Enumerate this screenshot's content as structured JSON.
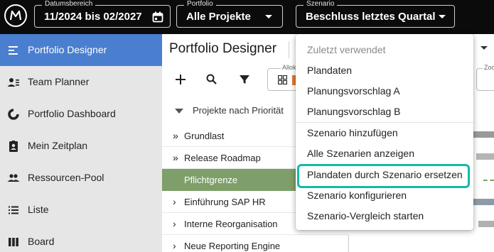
{
  "topbar": {
    "date_range": {
      "label": "Datumsbereich",
      "value": "11/2024 bis 02/2027",
      "icon": "calendar-icon"
    },
    "portfolio": {
      "label": "Portfolio",
      "value": "Alle Projekte"
    },
    "scenario": {
      "label": "Szenario",
      "value": "Beschluss letztes Quartal"
    }
  },
  "sidebar": {
    "items": [
      {
        "label": "Portfolio Designer",
        "icon": "portfolio-designer-icon",
        "active": true
      },
      {
        "label": "Team Planner",
        "icon": "team-planner-icon",
        "active": false
      },
      {
        "label": "Portfolio Dashboard",
        "icon": "dashboard-icon",
        "active": false
      },
      {
        "label": "Mein Zeitplan",
        "icon": "schedule-icon",
        "active": false
      },
      {
        "label": "Ressourcen-Pool",
        "icon": "resource-pool-icon",
        "active": false
      },
      {
        "label": "Liste",
        "icon": "list-icon",
        "active": false
      },
      {
        "label": "Board",
        "icon": "board-icon",
        "active": false
      }
    ]
  },
  "main": {
    "title": "Portfolio Designer",
    "toolbar": {
      "alloc_label": "Allok",
      "zoom_label": "Zoo"
    },
    "tree_header": "Projekte nach Priorität",
    "rows": [
      {
        "label": "Grundlast",
        "chevron": "»"
      },
      {
        "label": "Release Roadmap",
        "chevron": "»"
      },
      {
        "label": "Pflichtgrenze",
        "chevron": ""
      },
      {
        "label": "Einführung SAP HR",
        "chevron": "›"
      },
      {
        "label": "Interne Reorganisation",
        "chevron": "›"
      },
      {
        "label": "Neue Reporting Engine",
        "chevron": "›"
      }
    ]
  },
  "scenario_menu": {
    "header": "Zuletzt verwendet",
    "items": [
      "Plandaten",
      "Planungsvorschlag A",
      "Planungsvorschlag B",
      "Szenario hinzufügen",
      "Alle Szenarien anzeigen",
      "Plandaten durch Szenario ersetzen",
      "Szenario konfigurieren",
      "Szenario-Vergleich starten"
    ],
    "highlighted_item": "Plandaten durch Szenario ersetzen",
    "highlight_color": "#15b8a8"
  },
  "colors": {
    "topbar_bg": "#0b0b0b",
    "sidebar_active": "#4a7fd0",
    "pflicht_row": "#7e9f6a"
  }
}
